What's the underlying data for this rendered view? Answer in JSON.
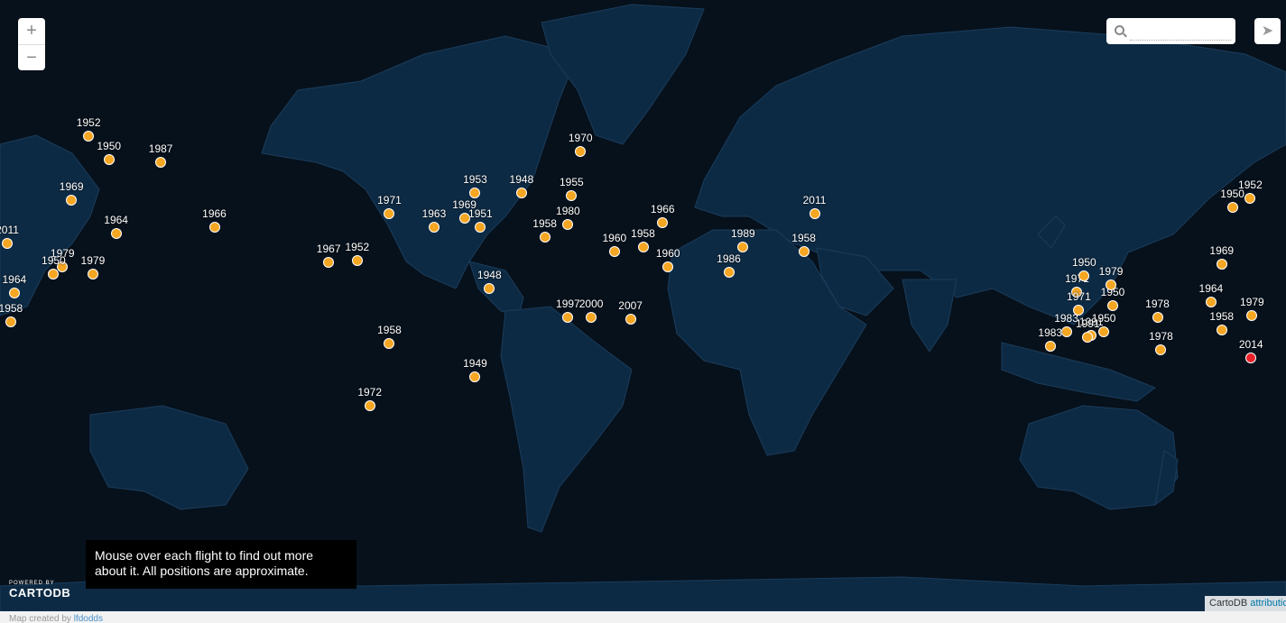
{
  "map": {
    "search": {
      "placeholder": "",
      "value": ""
    },
    "zoom": {
      "in_label": "+",
      "out_label": "−"
    },
    "share_icon": "paper-plane-icon",
    "marker_color": "#f5a623",
    "highlight_color": "#e8202a",
    "infobox_text": "Mouse over each flight to find out more about it. All positions are approximate.",
    "powered_by": "POWERED BY",
    "logo_text": "CARTODB",
    "attribution": {
      "prefix": "CartoDB ",
      "link": "attribution"
    },
    "footer": {
      "text": "Map created by ",
      "author": "lfdodds"
    }
  },
  "markers": [
    {
      "lon": 170.2,
      "lat": 4.0,
      "year": "2014",
      "color": "red"
    },
    {
      "lon": -178.0,
      "lat": 37.0,
      "year": "2011"
    },
    {
      "lon": -149.5,
      "lat": 55.0,
      "year": "1950"
    },
    {
      "lon": -155.2,
      "lat": 59.0,
      "year": "1952"
    },
    {
      "lon": -160.0,
      "lat": 47.0,
      "year": "1969"
    },
    {
      "lon": -135.0,
      "lat": 54.5,
      "year": "1987"
    },
    {
      "lon": -147.5,
      "lat": 39.5,
      "year": "1964"
    },
    {
      "lon": -162.5,
      "lat": 31.0,
      "year": "1979"
    },
    {
      "lon": -165.0,
      "lat": 29.0,
      "year": "1950"
    },
    {
      "lon": -120.0,
      "lat": 41.0,
      "year": "1966"
    },
    {
      "lon": -154.0,
      "lat": 29.0,
      "year": "1979"
    },
    {
      "lon": -177.0,
      "lat": 15.0,
      "year": "1958"
    },
    {
      "lon": -176.0,
      "lat": 23.5,
      "year": "1964"
    },
    {
      "lon": 145.0,
      "lat": 6.5,
      "year": "1978"
    },
    {
      "lon": 121.5,
      "lat": 24.0,
      "year": "1971"
    },
    {
      "lon": 131.5,
      "lat": 20.0,
      "year": "1950"
    },
    {
      "lon": 118.5,
      "lat": 12.0,
      "year": "1983"
    },
    {
      "lon": 125.5,
      "lat": 11.0,
      "year": "1991"
    },
    {
      "lon": -47.0,
      "lat": 48.5,
      "year": "1953"
    },
    {
      "lon": -34.0,
      "lat": 48.5,
      "year": "1948"
    },
    {
      "lon": -17.5,
      "lat": 56.5,
      "year": "1970"
    },
    {
      "lon": -20.0,
      "lat": 48.0,
      "year": "1955"
    },
    {
      "lon": -71.0,
      "lat": 44.0,
      "year": "1971"
    },
    {
      "lon": -58.5,
      "lat": 41.0,
      "year": "1963"
    },
    {
      "lon": -50.0,
      "lat": 43.0,
      "year": "1969"
    },
    {
      "lon": -45.5,
      "lat": 41.0,
      "year": "1951"
    },
    {
      "lon": -88.0,
      "lat": 32.0,
      "year": "1967"
    },
    {
      "lon": -80.0,
      "lat": 32.5,
      "year": "1952"
    },
    {
      "lon": -43.0,
      "lat": 25.0,
      "year": "1948"
    },
    {
      "lon": -27.5,
      "lat": 38.5,
      "year": "1958"
    },
    {
      "lon": -21.0,
      "lat": 41.5,
      "year": "1980"
    },
    {
      "lon": -8.0,
      "lat": 35.0,
      "year": "1960"
    },
    {
      "lon": 0.0,
      "lat": 36.0,
      "year": "1958"
    },
    {
      "lon": 5.5,
      "lat": 42.0,
      "year": "1966"
    },
    {
      "lon": 7.0,
      "lat": 31.0,
      "year": "1960"
    },
    {
      "lon": 24.0,
      "lat": 29.5,
      "year": "1986"
    },
    {
      "lon": 28.0,
      "lat": 36.0,
      "year": "1989"
    },
    {
      "lon": 48.0,
      "lat": 44.0,
      "year": "2011"
    },
    {
      "lon": 45.0,
      "lat": 35.0,
      "year": "1958"
    },
    {
      "lon": -21.0,
      "lat": 16.5,
      "year": "1997"
    },
    {
      "lon": -14.5,
      "lat": 16.5,
      "year": "2000"
    },
    {
      "lon": -3.5,
      "lat": 16.0,
      "year": "2007"
    },
    {
      "lon": -71.0,
      "lat": 8.5,
      "year": "1958"
    },
    {
      "lon": -47.0,
      "lat": -2.0,
      "year": "1949"
    },
    {
      "lon": -76.5,
      "lat": -11.0,
      "year": "1972"
    },
    {
      "lon": 165.0,
      "lat": 45.5,
      "year": "1950"
    },
    {
      "lon": 170.0,
      "lat": 47.5,
      "year": "1952"
    },
    {
      "lon": 162.0,
      "lat": 31.5,
      "year": "1969"
    },
    {
      "lon": 123.5,
      "lat": 28.5,
      "year": "1950"
    },
    {
      "lon": 131.0,
      "lat": 26.0,
      "year": "1979"
    },
    {
      "lon": 162.0,
      "lat": 12.5,
      "year": "1958"
    },
    {
      "lon": 159.0,
      "lat": 21.0,
      "year": "1964"
    },
    {
      "lon": 170.5,
      "lat": 17.0,
      "year": "1979"
    },
    {
      "lon": 144.0,
      "lat": 16.5,
      "year": "1978"
    },
    {
      "lon": 122.0,
      "lat": 18.5,
      "year": "1971"
    },
    {
      "lon": 129.0,
      "lat": 12.0,
      "year": "1950"
    },
    {
      "lon": 114.0,
      "lat": 7.5,
      "year": "1983"
    },
    {
      "lon": 124.5,
      "lat": 10.5,
      "year": "1991"
    }
  ]
}
